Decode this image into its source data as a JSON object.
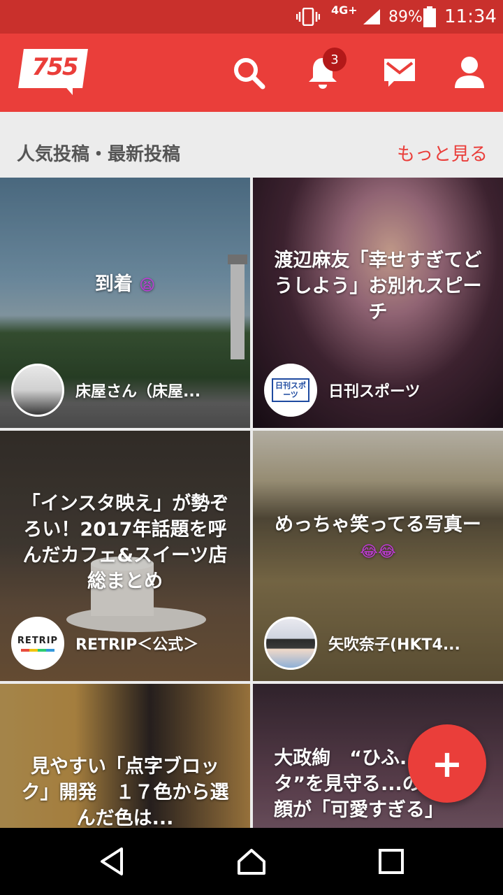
{
  "status_bar": {
    "network": "4G+",
    "battery": "89%",
    "time": "11:34"
  },
  "app_bar": {
    "logo_text": "755",
    "notification_count": "3",
    "icons": [
      "search-icon",
      "bell-icon",
      "mail-icon",
      "user-icon"
    ]
  },
  "section": {
    "title": "人気投稿・最新投稿",
    "more_label": "もっと見る"
  },
  "posts": [
    {
      "title": "到着",
      "title_emoji": "😫",
      "author": "床屋さん（床屋..."
    },
    {
      "title": "渡辺麻友「幸せすぎてどうしよう」お別れスピーチ",
      "author": "日刊スポーツ",
      "avatar_text": "日刊スポーツ"
    },
    {
      "title": "「インスタ映え」が勢ぞろい！2017年話題を呼んだカフェ&スイーツ店総まとめ",
      "author": "RETRIP＜公式＞",
      "avatar_text": "RETRIP"
    },
    {
      "title": "めっちゃ笑ってる写真ー",
      "title_emoji": "😂😂",
      "author": "矢吹奈子(HKT4..."
    },
    {
      "title": "見やすい「点字ブロック」開発　１７色から選んだ色は..."
    },
    {
      "title": "大政絢　“ひふ...ンタ”を見守る...の笑顔が「可愛すぎる」"
    }
  ],
  "fab": {
    "label": "+"
  },
  "colors": {
    "brand_red": "#ea3e3a",
    "status_bar": "#c9302c",
    "badge": "#b31919"
  }
}
